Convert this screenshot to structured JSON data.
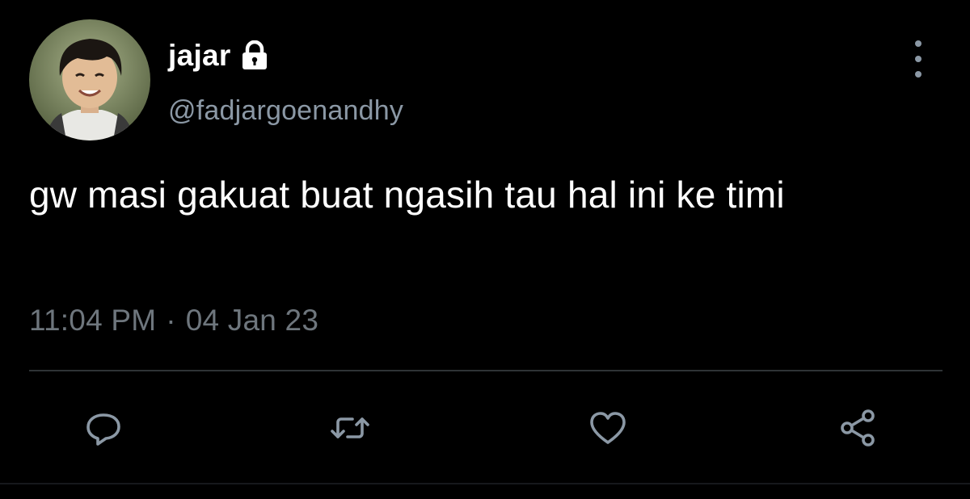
{
  "tweet": {
    "display_name": "jajar",
    "handle": "@fadjargoenandhy",
    "text": "gw masi gakuat buat ngasih tau hal ini ke timi",
    "time": "11:04 PM",
    "separator": "·",
    "date": "04 Jan 23",
    "account_locked": true
  },
  "icons": {
    "lock": "lock-icon",
    "more": "more-vertical-icon",
    "reply": "reply-icon",
    "retweet": "retweet-icon",
    "like": "heart-icon",
    "share": "share-icon"
  },
  "colors": {
    "background": "#000000",
    "primary_text": "#ffffff",
    "secondary_text": "#8b98a5",
    "timestamp_text": "#6e767d",
    "divider": "#2f3336",
    "icon": "#8b98a5"
  }
}
